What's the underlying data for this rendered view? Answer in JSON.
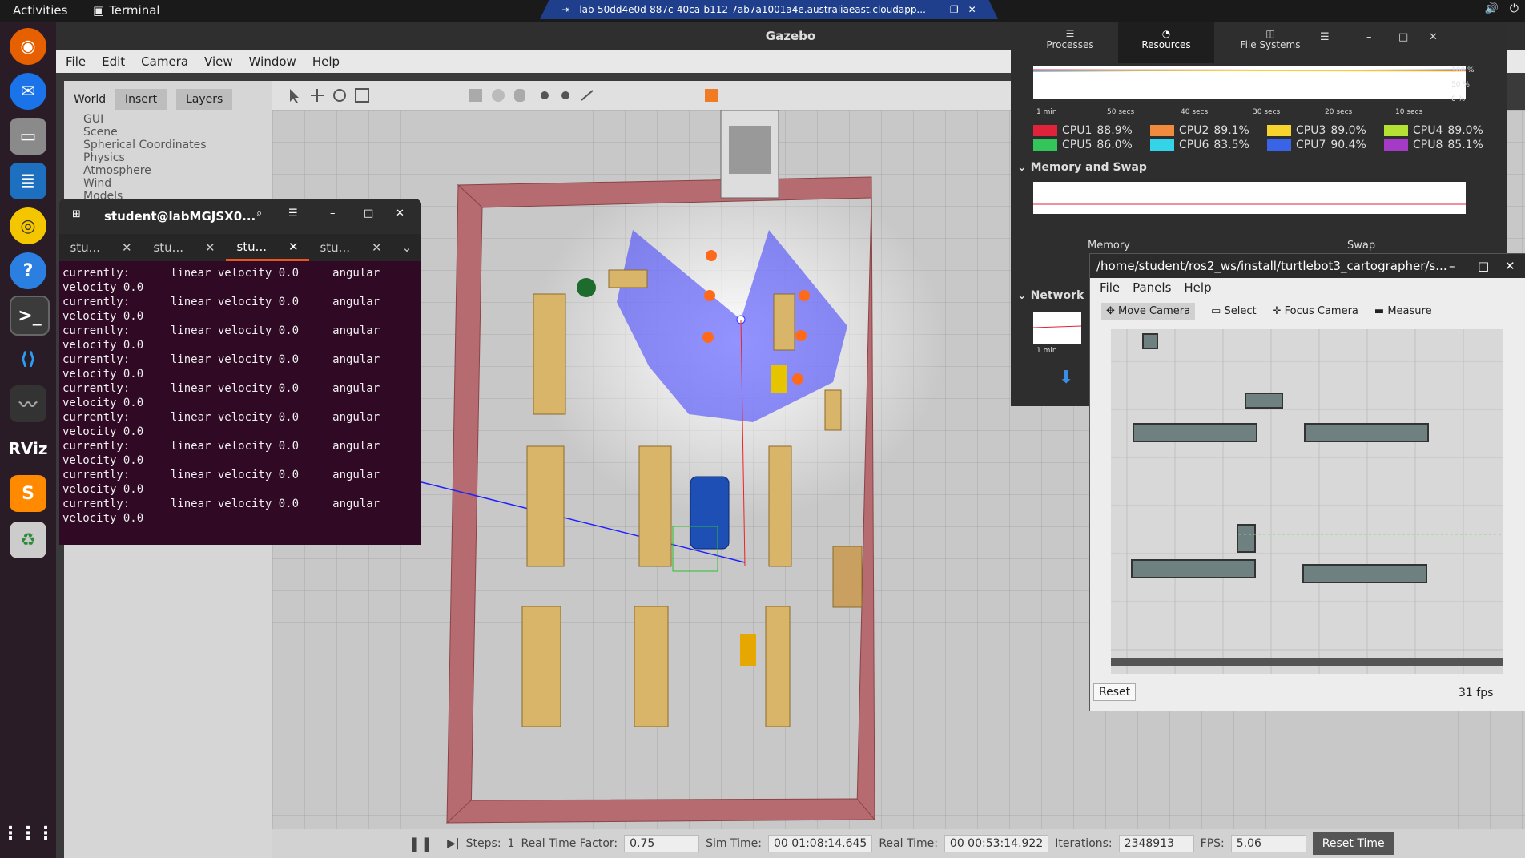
{
  "topbar": {
    "activities": "Activities",
    "app": "Terminal",
    "vnc_title": "lab-50dd4e0d-887c-40ca-b112-7ab7a1001a4e.australiaeast.cloudapp..."
  },
  "dock": {
    "items": [
      "firefox-icon",
      "thunderbird-icon",
      "files-icon",
      "writer-icon",
      "rhythmbox-icon",
      "help-icon",
      "terminal-icon",
      "vscode-icon",
      "system-monitor-icon",
      "rviz-icon",
      "sublime-icon",
      "trash-icon",
      "apps-grid-icon"
    ],
    "rviz_label": "RViz"
  },
  "gazebo": {
    "title": "Gazebo",
    "menu": [
      "File",
      "Edit",
      "Camera",
      "View",
      "Window",
      "Help"
    ],
    "tabs": [
      "World",
      "Insert",
      "Layers"
    ],
    "tree": [
      "GUI",
      "Scene",
      "Spherical Coordinates",
      "Physics",
      "Atmosphere",
      "Wind",
      "Models"
    ],
    "status": {
      "steps_label": "Steps:",
      "steps": "1",
      "rtf_label": "Real Time Factor:",
      "rtf": "0.75",
      "sim_label": "Sim Time:",
      "sim": "00 01:08:14.645",
      "real_label": "Real Time:",
      "real": "00 00:53:14.922",
      "iter_label": "Iterations:",
      "iter": "2348913",
      "fps_label": "FPS:",
      "fps": "5.06",
      "reset": "Reset Time"
    }
  },
  "terminal": {
    "title": "student@labMGJSX0...",
    "tabs": [
      "stu...",
      "stu...",
      "stu...",
      "stu..."
    ],
    "active_tab": 2,
    "lines": [
      "currently:      linear velocity 0.0     angular",
      "velocity 0.0",
      "currently:      linear velocity 0.0     angular",
      "velocity 0.0",
      "currently:      linear velocity 0.0     angular",
      "velocity 0.0",
      "currently:      linear velocity 0.0     angular",
      "velocity 0.0",
      "currently:      linear velocity 0.0     angular",
      "velocity 0.0",
      "currently:      linear velocity 0.0     angular",
      "velocity 0.0",
      "currently:      linear velocity 0.0     angular",
      "velocity 0.0",
      "currently:      linear velocity 0.0     angular",
      "velocity 0.0",
      "currently:      linear velocity 0.0     angular",
      "velocity 0.0"
    ]
  },
  "sysmon": {
    "tabs": [
      "Processes",
      "Resources",
      "File Systems"
    ],
    "axis_pct": [
      "100 %",
      "50 %",
      "0 %"
    ],
    "axis_time": [
      "1 min",
      "50 secs",
      "40 secs",
      "30 secs",
      "20 secs",
      "10 secs"
    ],
    "cpus": [
      {
        "name": "CPU1",
        "value": "88.9%",
        "color": "#e0223b"
      },
      {
        "name": "CPU2",
        "value": "89.1%",
        "color": "#f08a3c"
      },
      {
        "name": "CPU3",
        "value": "89.0%",
        "color": "#f6d32d"
      },
      {
        "name": "CPU4",
        "value": "89.0%",
        "color": "#b5e134"
      },
      {
        "name": "CPU5",
        "value": "86.0%",
        "color": "#33c45a"
      },
      {
        "name": "CPU6",
        "value": "83.5%",
        "color": "#34d4e8"
      },
      {
        "name": "CPU7",
        "value": "90.4%",
        "color": "#3a64e8"
      },
      {
        "name": "CPU8",
        "value": "85.1%",
        "color": "#a43ac6"
      }
    ],
    "mem_section": "Memory and Swap",
    "mem_label": "Memory",
    "swap_label": "Swap",
    "net_section": "Network",
    "net_axis": "1 min"
  },
  "rviz": {
    "title": "/home/student/ros2_ws/install/turtlebot3_cartographer/s...",
    "menu": [
      "File",
      "Panels",
      "Help"
    ],
    "tools": [
      "Move Camera",
      "Select",
      "Focus Camera",
      "Measure"
    ],
    "reset": "Reset",
    "fps": "31 fps"
  }
}
